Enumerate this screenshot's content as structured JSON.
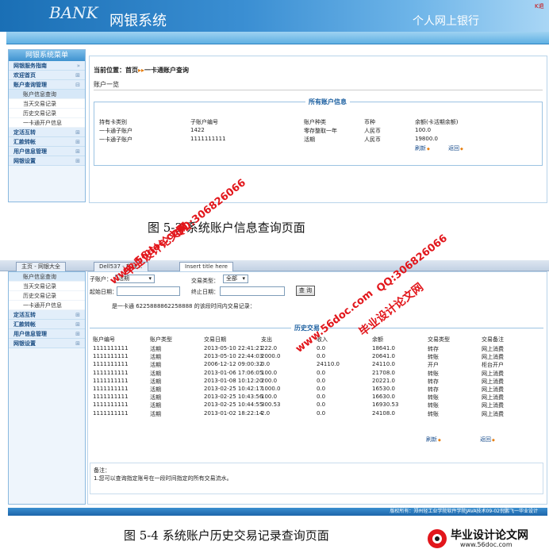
{
  "shot1": {
    "brand": "BANK",
    "system_title": "网银系统",
    "personal_bank": "个人网上银行",
    "corner_mark": "K退",
    "sidebar": {
      "title": "网银系统菜单",
      "items": [
        {
          "label": "网银服务指南",
          "toggle": "»"
        },
        {
          "label": "欢迎首页",
          "toggle": "⊞"
        },
        {
          "label": "账户查询管理",
          "toggle": "⊟"
        },
        {
          "label": "定活互转",
          "toggle": "⊞"
        },
        {
          "label": "汇款转帐",
          "toggle": "⊞"
        },
        {
          "label": "用户信息管理",
          "toggle": "⊞"
        },
        {
          "label": "网银设置",
          "toggle": "⊞"
        }
      ],
      "subitems": [
        "账户信息查询",
        "当天交易记录",
        "历史交易记录",
        "一卡通开户信息"
      ]
    },
    "breadcrumb": {
      "prefix": "当前位置：",
      "home": "首页",
      "arrows": "▸▸",
      "current": "一卡通账户查询"
    },
    "section_label": "账户一览",
    "panel_title": "所有账户信息",
    "table": {
      "headers": [
        "持有卡类别",
        "子账户编号",
        "账户种类",
        "币种",
        "余额(卡活期余额)"
      ],
      "rows": [
        [
          "一卡通子账户",
          "1422",
          "零存整取一年",
          "人民币",
          "100.0"
        ],
        [
          "一卡通子账户",
          "1111111111",
          "活期",
          "人民币",
          "19800.0"
        ]
      ]
    },
    "refresh": "刷新",
    "back": "返回"
  },
  "caption1": "图 5-3  系统账户信息查询页面",
  "shot2": {
    "tabs": [
      "主页 - 网银大全",
      "Dell537 - 在线...",
      "Insert title here"
    ],
    "sidebar_subitems": [
      "账户信息查询",
      "当天交易记录",
      "历史交易记录",
      "一卡通开户信息"
    ],
    "sidebar_items": [
      {
        "label": "定活互转",
        "toggle": "⊞"
      },
      {
        "label": "汇款转帐",
        "toggle": "⊞"
      },
      {
        "label": "用户信息管理",
        "toggle": "⊞"
      },
      {
        "label": "网银设置",
        "toggle": "⊞"
      }
    ],
    "filters": {
      "sub_account_label": "子账户：",
      "sub_account_value": "活期",
      "txn_type_label": "交易类型：",
      "txn_type_value": "全部",
      "start_label": "起始日期：",
      "end_label": "终止日期：",
      "query_button": "查 询"
    },
    "info_line": "是一卡通 6225888862258888 的该段时间内交易记录：",
    "panel_title": "历史交易",
    "table": {
      "headers": [
        "账户编号",
        "账户类型",
        "交易日期",
        "支出",
        "收入",
        "余额",
        "交易类型",
        "交易备注"
      ],
      "rows": [
        [
          "1111111111",
          "活期",
          "2013-05-10 22:41:21",
          "222.0",
          "0.0",
          "18641.0",
          "转存",
          "网上消费"
        ],
        [
          "1111111111",
          "活期",
          "2013-05-10 22:44:03",
          "2000.0",
          "0.0",
          "20641.0",
          "转账",
          "网上消费"
        ],
        [
          "1111111111",
          "活期",
          "2006-12-12 09:00:32",
          "0.0",
          "24110.0",
          "24110.0",
          "开户",
          "柜台开户"
        ],
        [
          "1111111111",
          "活期",
          "2013-01-06 17:06:05",
          "100.0",
          "0.0",
          "21708.0",
          "转账",
          "网上消费"
        ],
        [
          "1111111111",
          "活期",
          "2013-01-08 10:12:20",
          "200.0",
          "0.0",
          "20221.0",
          "转存",
          "网上消费"
        ],
        [
          "1111111111",
          "活期",
          "2013-02-25 10:42:17",
          "1000.0",
          "0.0",
          "16530.0",
          "转存",
          "网上消费"
        ],
        [
          "1111111111",
          "活期",
          "2013-02-25 10:43:56",
          "100.0",
          "0.0",
          "16630.0",
          "转账",
          "网上消费"
        ],
        [
          "1111111111",
          "活期",
          "2013-02-25 10:44:55",
          "300.53",
          "0.0",
          "16930.53",
          "转账",
          "网上消费"
        ],
        [
          "1111111111",
          "活期",
          "2013-01-02 18:22:14",
          "2.0",
          "0.0",
          "24108.0",
          "转账",
          "网上消费"
        ]
      ]
    },
    "refresh": "刷新",
    "back": "返回",
    "note_title": "备注：",
    "note_text": "1.您可以查询指定账号在一段时间指定的所有交易流水。",
    "footer": "版权所有：郑州轻工业学院软件学院JAVA技术09-02倪鹏飞一毕业设计"
  },
  "caption2": "图 5-4  系统账户历史交易记录查询页面",
  "watermarks": {
    "url": "www.56doc.com",
    "site": "毕业设计论文网",
    "qq": "QQ:306826066"
  },
  "logo": {
    "name": "毕业设计论文网",
    "url": "www.56doc.com"
  },
  "colors": {
    "header_blue": "#1a6fb5",
    "accent_orange": "#e67e10",
    "link_blue": "#1b4f8e",
    "watermark_red": "#e2161b"
  }
}
